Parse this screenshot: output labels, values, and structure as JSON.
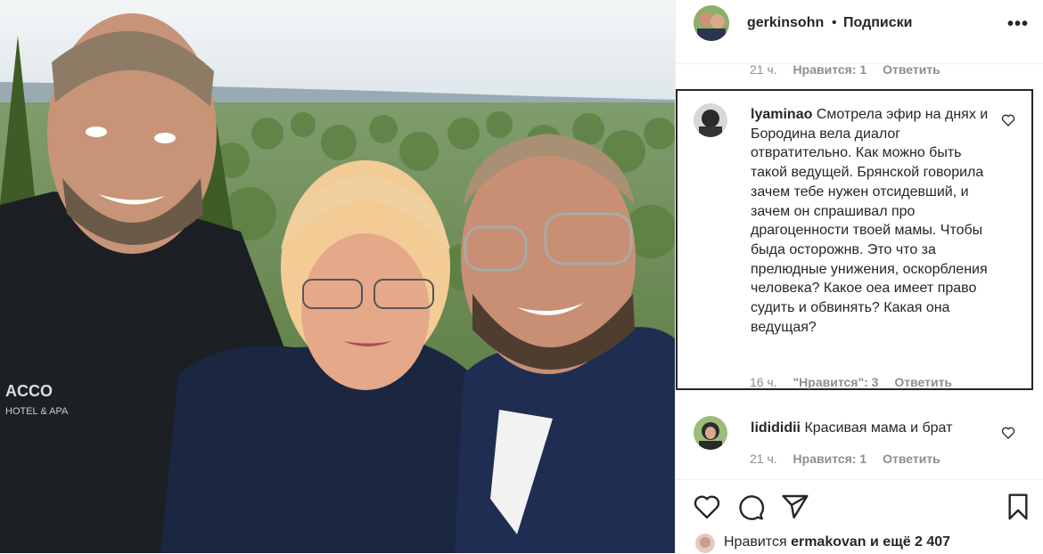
{
  "post": {
    "author": "gerkinsohn",
    "separator": "•",
    "follow_label": "Подписки",
    "more_label": "•••"
  },
  "comments": [
    {
      "time": "21 ч.",
      "likes": "Нравится: 1",
      "reply": "Ответить"
    },
    {
      "user": "lyaminao",
      "text": "Смотрела эфир на днях и Бородина вела диалог отвратительно. Как можно быть такой ведущей. Брянской говорила зачем тебе нужен отсидевший, и зачем он спрашивал про драгоценности твоей мамы. Чтобы быда осторожнв. Это что за прелюдные унижения, оскорбления человека? Какое оеа имеет право судить и обвинять? Какая она ведущая?",
      "time": "16 ч.",
      "likes": "\"Нравится\": 3",
      "reply": "Ответить"
    },
    {
      "user": "lidididii",
      "text": "Красивая мама и брат",
      "time": "21 ч.",
      "likes": "Нравится: 1",
      "reply": "Ответить"
    }
  ],
  "likes_line": {
    "prefix": "Нравится",
    "user": "ermakovan",
    "suffix": "и ещё 2 407"
  },
  "icons": [
    "heart-icon",
    "comment-icon",
    "share-icon",
    "bookmark-icon",
    "more-icon"
  ],
  "colors": {
    "text": "#262626",
    "muted": "#8e8e8e",
    "border": "#efefef"
  }
}
